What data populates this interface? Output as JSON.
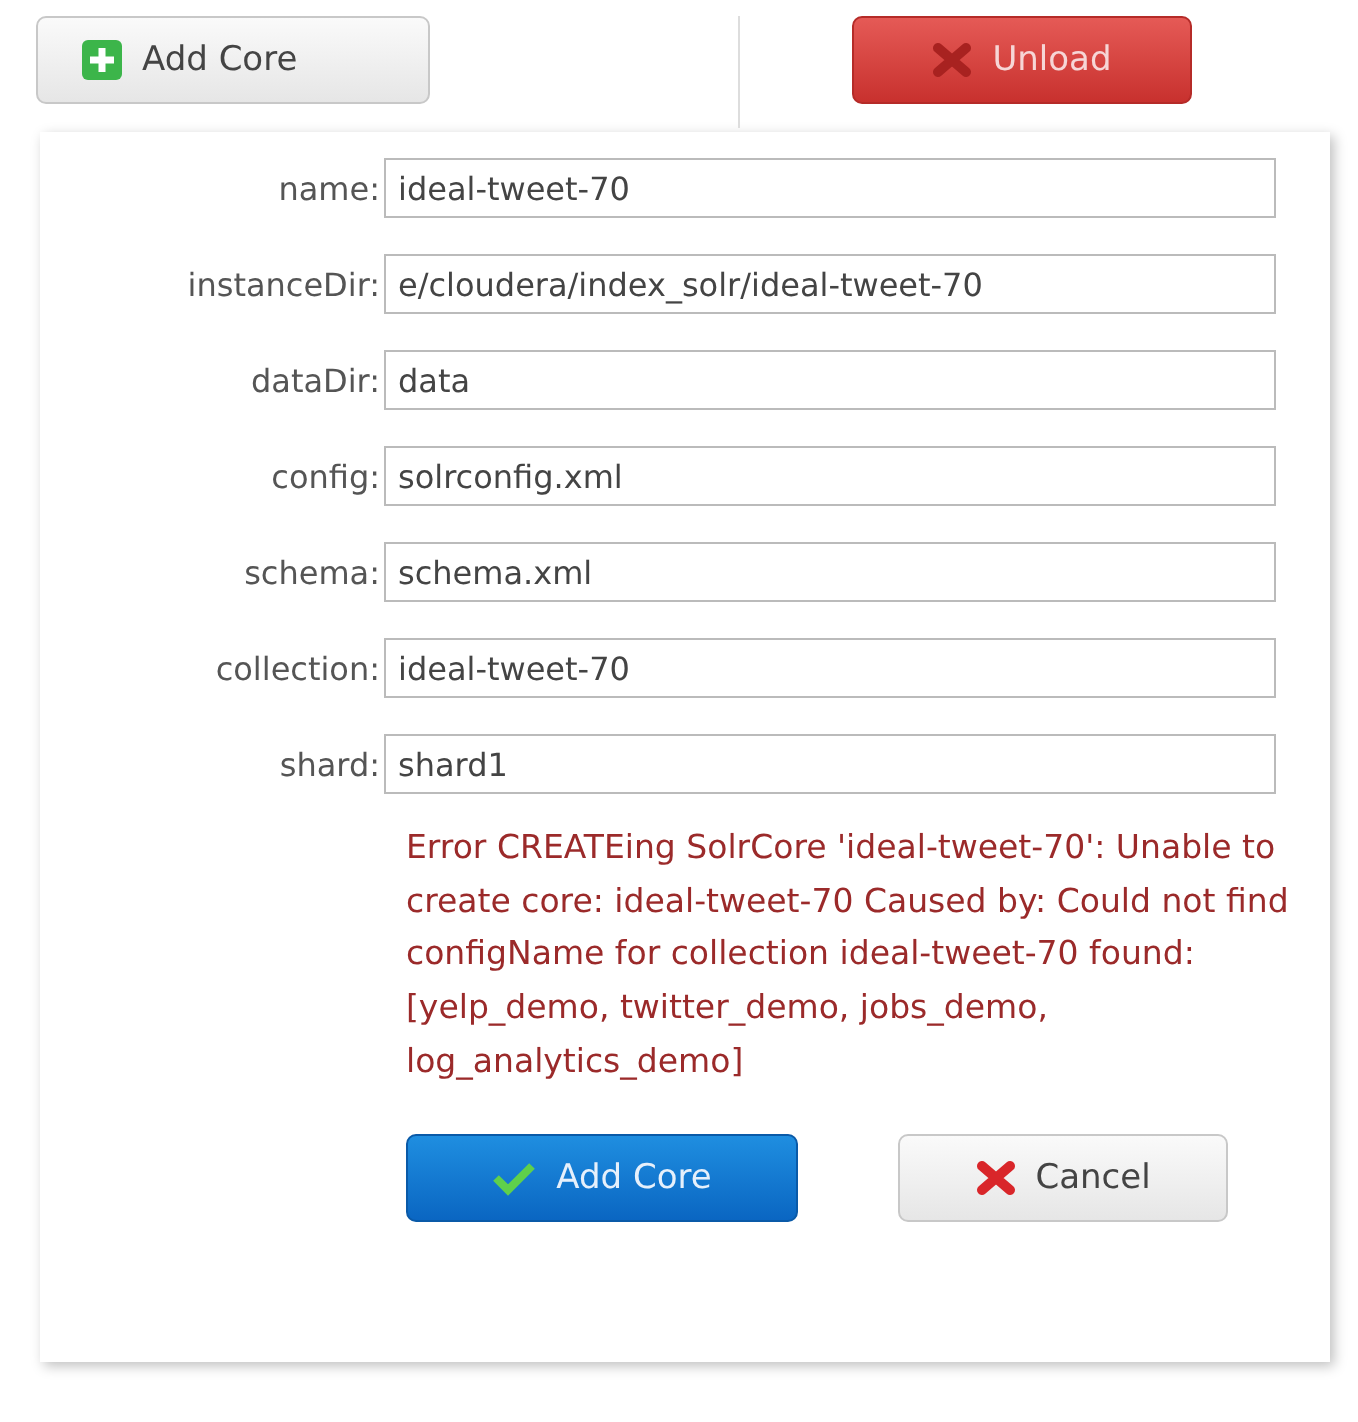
{
  "toolbar": {
    "add_button": "Add Core",
    "unload_button": "Unload"
  },
  "form": {
    "fields": [
      {
        "label": "name:",
        "value": "ideal-tweet-70"
      },
      {
        "label": "instanceDir:",
        "value": "e/cloudera/index_solr/ideal-tweet-70"
      },
      {
        "label": "dataDir:",
        "value": "data"
      },
      {
        "label": "config:",
        "value": "solrconfig.xml"
      },
      {
        "label": "schema:",
        "value": "schema.xml"
      },
      {
        "label": "collection:",
        "value": "ideal-tweet-70"
      },
      {
        "label": "shard:",
        "value": "shard1"
      }
    ],
    "error": "Error CREATEing SolrCore 'ideal-tweet-70': Unable to create core: ideal-tweet-70 Caused by: Could not find configName for collection ideal-tweet-70 found:[yelp_demo, twitter_demo, jobs_demo, log_analytics_demo]",
    "buttons": [
      {
        "kind": "submit",
        "label": "Add Core"
      },
      {
        "kind": "cancel",
        "label": "Cancel"
      }
    ]
  }
}
